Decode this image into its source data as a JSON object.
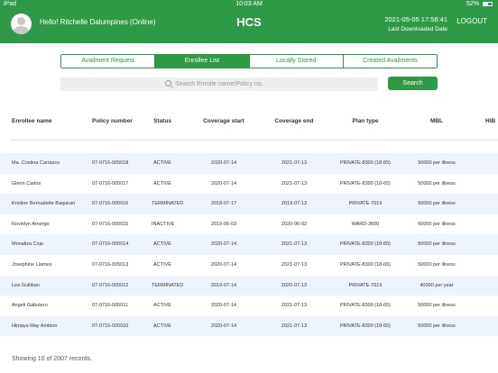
{
  "statusbar": {
    "device": "iPad",
    "time": "10:03 AM",
    "battery": "52%"
  },
  "header": {
    "greeting": "Hello! Ritchelle Dalumpines (Online)",
    "title": "HCS",
    "datetime": "2021-05-05 17:58:41",
    "last_downloaded_label": "Last Downloaded Date",
    "logout_label": "LOGOUT"
  },
  "tabs": [
    {
      "label": "Availment Request"
    },
    {
      "label": "Enrollee List",
      "active": true
    },
    {
      "label": "Locally Stored"
    },
    {
      "label": "Created Availments"
    }
  ],
  "search": {
    "placeholder": "Search Enrolle name/Policy no.",
    "button_label": "Search"
  },
  "table": {
    "columns": [
      "Enrollee name",
      "Policy number",
      "Status",
      "Coverage start",
      "Coverage end",
      "Plan type",
      "MBL",
      "HIB"
    ],
    "rows": [
      [
        "Ma. Cristina Carrasco",
        "07-0716-005018",
        "ACTIVE",
        "2020-07-14",
        "2021-07-13",
        "PRIVATE-8300 (18-65)",
        "50000 per illness",
        ""
      ],
      [
        "Glenn Carlos",
        "07-0716-005017",
        "ACTIVE",
        "2020-07-14",
        "2021-07-13",
        "PRIVATE-8300 (18-65)",
        "50000 per illness",
        ""
      ],
      [
        "Kristine Bernadette Baquiran",
        "07-0716-005016",
        "TERMINATED",
        "2018-07-17",
        "2019-07-13",
        "PRIVATE-7019",
        "50000 per illness",
        ""
      ],
      [
        "Rovielyn Amergo",
        "07-0716-005015",
        "INACTIVE",
        "2019-06-03",
        "2020-06-02",
        "WARD-3600",
        "60000 per illness",
        ""
      ],
      [
        "Monaliza Coja",
        "07-0716-005014",
        "ACTIVE",
        "2020-07-14",
        "2021-07-13",
        "PRIVATE-8300 (18-65)",
        "50000 per illness",
        ""
      ],
      [
        "Josephine Llames",
        "07-0716-005013",
        "ACTIVE",
        "2020-07-14",
        "2021-07-13",
        "PRIVATE-8300 (18-65)",
        "50000 per illness",
        ""
      ],
      [
        "Lea Guiliban",
        "07-0716-005012",
        "TERMINATED",
        "2019-07-14",
        "2020-07-13",
        "PRIVATE-7019",
        "40000 per year",
        ""
      ],
      [
        "Angeli Gabutero",
        "07-0716-005011",
        "ACTIVE",
        "2020-07-14",
        "2021-07-13",
        "PRIVATE-8300 (18-65)",
        "50000 per illness",
        ""
      ],
      [
        "Himaya May Ambion",
        "07-0716-005010",
        "ACTIVE",
        "2020-07-14",
        "2021-07-13",
        "PRIVATE-8300 (18-65)",
        "50000 per illness",
        ""
      ]
    ]
  },
  "footer": {
    "records_text": "Showing 10 of 2007 records."
  },
  "colors": {
    "brand": "#2e9a46",
    "row_alt": "#eef4fb"
  }
}
